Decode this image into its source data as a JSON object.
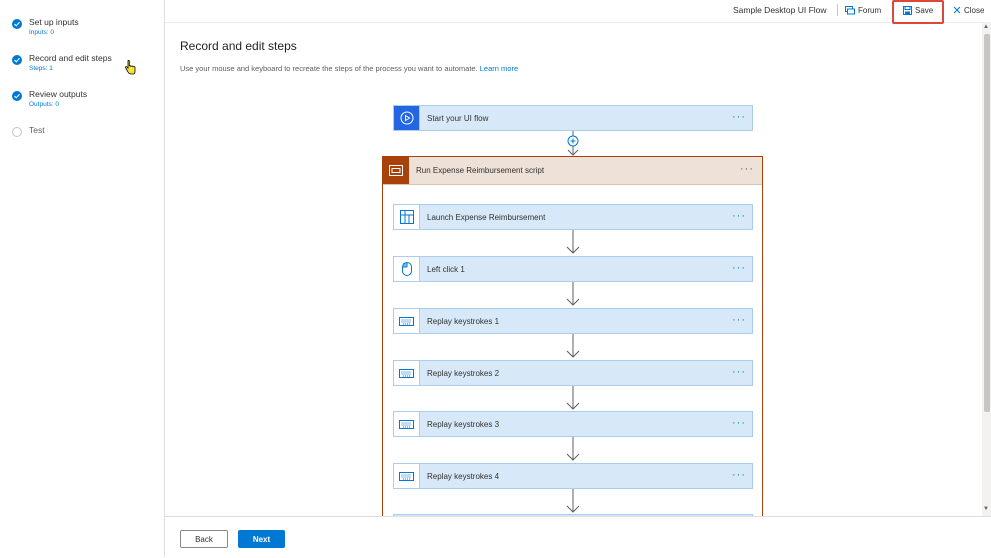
{
  "sidebar": {
    "steps": [
      {
        "label": "Set up inputs",
        "sub": "Inputs: 0",
        "state": "done"
      },
      {
        "label": "Record and edit steps",
        "sub": "Steps: 1",
        "state": "done"
      },
      {
        "label": "Review outputs",
        "sub": "Outputs: 0",
        "state": "done"
      },
      {
        "label": "Test",
        "sub": "",
        "state": "pending"
      }
    ]
  },
  "topbar": {
    "flow_name": "Sample Desktop UI Flow",
    "forum": "Forum",
    "save": "Save",
    "close": "Close"
  },
  "main": {
    "title": "Record and edit steps",
    "description": "Use your mouse and keyboard to recreate the steps of the process you want to automate.",
    "learn_more": "Learn more",
    "start_card": "Start your UI flow",
    "scope_label": "Run Expense Reimbursement script",
    "actions": [
      {
        "label": "Launch Expense Reimbursement",
        "icon": "app-launch-icon"
      },
      {
        "label": "Left click 1",
        "icon": "mouse-icon"
      },
      {
        "label": "Replay keystrokes 1",
        "icon": "keyboard-icon"
      },
      {
        "label": "Replay keystrokes 2",
        "icon": "keyboard-icon"
      },
      {
        "label": "Replay keystrokes 3",
        "icon": "keyboard-icon"
      },
      {
        "label": "Replay keystrokes 4",
        "icon": "keyboard-icon"
      }
    ],
    "more": "···"
  },
  "footer": {
    "back": "Back",
    "next": "Next"
  },
  "colors": {
    "accent": "#0078d4",
    "scope": "#a8410a",
    "card_fill": "#d7e9f9",
    "highlight": "#e0453a"
  }
}
